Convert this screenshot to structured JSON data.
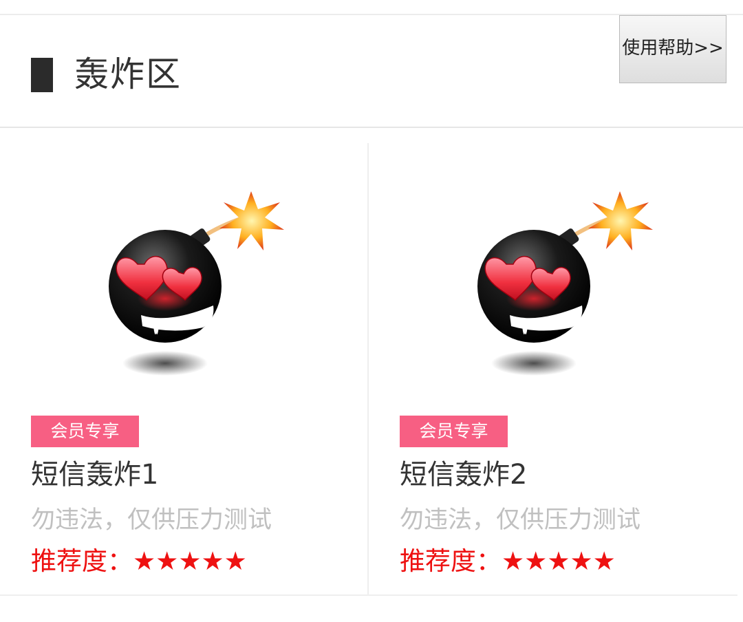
{
  "header": {
    "title": "轰炸区",
    "help_label": "使用帮助>>"
  },
  "cards": [
    {
      "badge": "会员专享",
      "title": "短信轰炸1",
      "description": "勿违法，仅供压力测试",
      "rating_label": "推荐度：",
      "stars": "★★★★★",
      "rating_value": 5,
      "image_icon": "bomb-icon"
    },
    {
      "badge": "会员专享",
      "title": "短信轰炸2",
      "description": "勿违法，仅供压力测试",
      "rating_label": "推荐度：",
      "stars": "★★★★★",
      "rating_value": 5,
      "image_icon": "bomb-icon"
    }
  ],
  "colors": {
    "badge": "#f75f83",
    "rating": "#ee1111",
    "description": "#c0c0c0",
    "title": "#333333"
  }
}
